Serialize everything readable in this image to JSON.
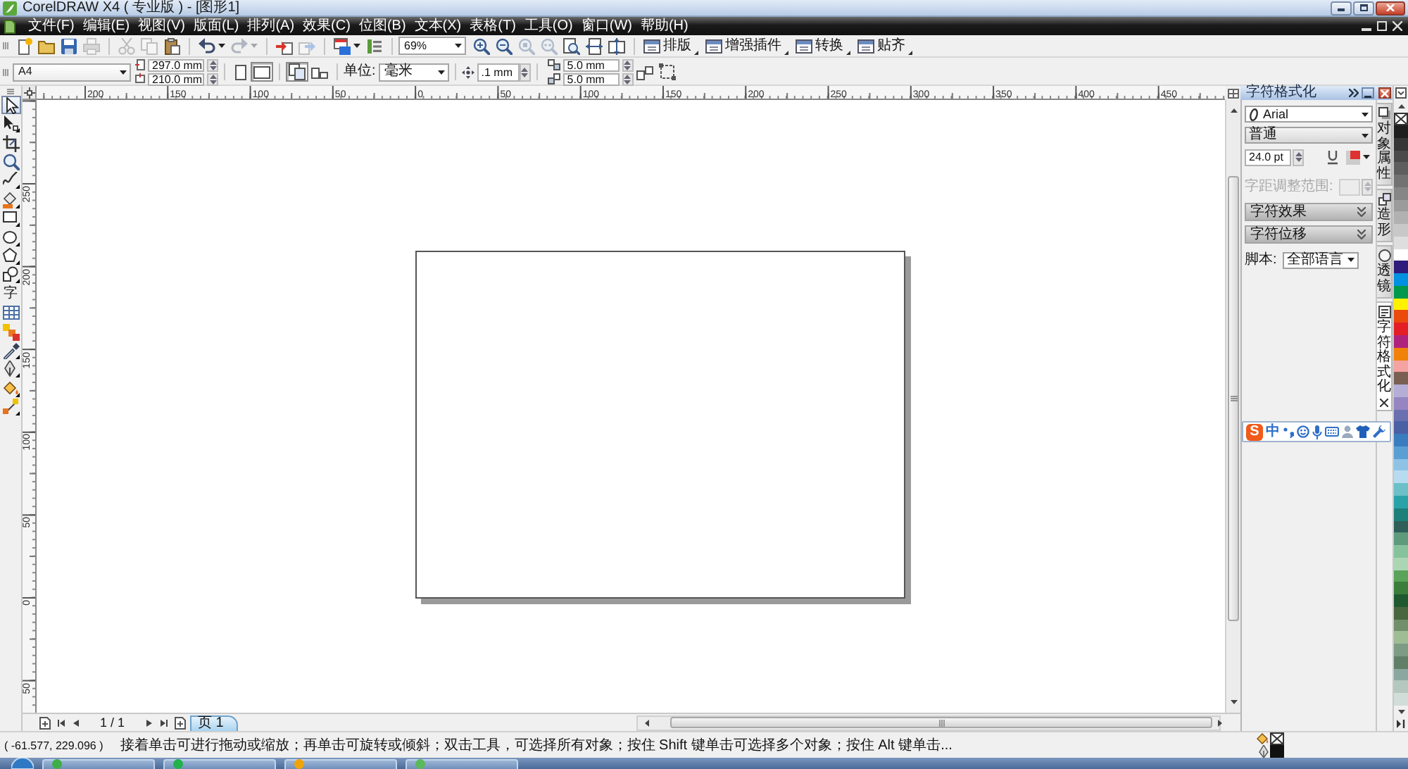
{
  "window": {
    "title": "CorelDRAW X4 ( 专业版 ) - [图形1]"
  },
  "menu": [
    "文件(F)",
    "编辑(E)",
    "视图(V)",
    "版面(L)",
    "排列(A)",
    "效果(C)",
    "位图(B)",
    "文本(X)",
    "表格(T)",
    "工具(O)",
    "窗口(W)",
    "帮助(H)"
  ],
  "toolbar": {
    "groups": [
      [
        {
          "kind": "new",
          "disabled": false
        },
        {
          "kind": "open",
          "disabled": false
        },
        {
          "kind": "save",
          "disabled": false
        },
        {
          "kind": "print",
          "disabled": true
        }
      ],
      [
        {
          "kind": "cut",
          "disabled": true
        },
        {
          "kind": "copy",
          "disabled": true
        },
        {
          "kind": "paste",
          "disabled": false
        }
      ],
      [
        {
          "kind": "undo",
          "disabled": false
        },
        {
          "kind": "redo",
          "disabled": true
        }
      ],
      [
        {
          "kind": "import",
          "disabled": false
        },
        {
          "kind": "export",
          "disabled": true
        }
      ],
      [
        {
          "kind": "launcher",
          "disabled": false
        },
        {
          "kind": "welcome",
          "disabled": false
        }
      ]
    ],
    "zoom_level": "69%",
    "zoom_tools": [
      {
        "kind": "zoom-in",
        "disabled": false
      },
      {
        "kind": "zoom-out",
        "disabled": false
      },
      {
        "kind": "zoom-selected",
        "disabled": true
      },
      {
        "kind": "zoom-all",
        "disabled": true
      },
      {
        "kind": "zoom-page",
        "disabled": false
      },
      {
        "kind": "zoom-width",
        "disabled": false
      },
      {
        "kind": "zoom-height",
        "disabled": false
      }
    ],
    "commands": [
      {
        "label": "排版"
      },
      {
        "label": "增强插件"
      },
      {
        "label": "转换"
      },
      {
        "label": "贴齐"
      }
    ]
  },
  "property_bar": {
    "paper_size": "A4",
    "width": "297.0 mm",
    "height": "210.0 mm",
    "orientations": [
      {
        "kind": "portrait",
        "selected": false
      },
      {
        "kind": "landscape",
        "selected": true
      }
    ],
    "page_scope": [
      {
        "kind": "all-pages",
        "selected": true
      },
      {
        "kind": "current-page",
        "selected": false
      }
    ],
    "units_label": "单位:",
    "units": "毫米",
    "nudge": ".1 mm",
    "duplicate_x": "5.0 mm",
    "duplicate_y": "5.0 mm"
  },
  "toolbox": [
    {
      "kind": "pick",
      "selected": true
    },
    {
      "kind": "shape",
      "selected": false
    },
    {
      "kind": "crop",
      "selected": false
    },
    {
      "kind": "zoom",
      "selected": false
    },
    {
      "kind": "freehand",
      "selected": false
    },
    {
      "kind": "smart-fill",
      "selected": false
    },
    {
      "kind": "rectangle",
      "selected": false
    },
    {
      "kind": "ellipse",
      "selected": false
    },
    {
      "kind": "polygon",
      "selected": false
    },
    {
      "kind": "basic-shapes",
      "selected": false
    },
    {
      "kind": "text",
      "glyph": "字",
      "selected": false
    },
    {
      "kind": "table",
      "selected": false
    },
    {
      "kind": "blend",
      "selected": false
    },
    {
      "kind": "eyedropper",
      "selected": false
    },
    {
      "kind": "outline",
      "selected": false
    },
    {
      "kind": "fill",
      "selected": false
    },
    {
      "kind": "interactive-fill",
      "selected": false
    }
  ],
  "rulers": {
    "horizontal": [
      "200",
      "150",
      "100",
      "50",
      "0",
      "50",
      "100",
      "150",
      "200",
      "250",
      "300",
      "350",
      "400",
      "450"
    ],
    "vertical": [
      "250",
      "200",
      "150",
      "100",
      "50",
      "0",
      "50"
    ]
  },
  "page_navigator": {
    "counter": "1 / 1",
    "pages": [
      {
        "label": "页 1",
        "selected": true
      }
    ]
  },
  "docker": {
    "title": "字符格式化",
    "font": "Arial",
    "style": "普通",
    "size": "24.0 pt",
    "kerning": {
      "label": "字距调整范围:",
      "disabled": true
    },
    "sections": [
      {
        "label": "字符效果",
        "expanded": false
      },
      {
        "label": "字符位移",
        "expanded": false
      }
    ],
    "script": {
      "label": "脚本:",
      "value": "全部语言"
    }
  },
  "docker_tabs": [
    {
      "kind": "properties",
      "label": "对象属性",
      "selected": false
    },
    {
      "kind": "shaping",
      "label": "造形",
      "selected": false
    },
    {
      "kind": "lens",
      "label": "透镜",
      "selected": false
    },
    {
      "kind": "character",
      "label": "字符格式化",
      "selected": true
    }
  ],
  "palette": [
    {
      "color": "#1e1e1e"
    },
    {
      "color": "#363636"
    },
    {
      "color": "#4a4a4a"
    },
    {
      "color": "#5e5e5e"
    },
    {
      "color": "#727272"
    },
    {
      "color": "#868686"
    },
    {
      "color": "#9b9b9b"
    },
    {
      "color": "#b1b1b1"
    },
    {
      "color": "#c8c8c8"
    },
    {
      "color": "#dedede"
    },
    {
      "color": "#ffffff"
    },
    {
      "color": "#2e1a7a"
    },
    {
      "color": "#0091e0"
    },
    {
      "color": "#00984a"
    },
    {
      "color": "#fff200"
    },
    {
      "color": "#ea4b0c"
    },
    {
      "color": "#e31e24"
    },
    {
      "color": "#b0237d"
    },
    {
      "color": "#f0820a"
    },
    {
      "color": "#f5a3a0"
    },
    {
      "color": "#7a6052"
    },
    {
      "color": "#b5aed6"
    },
    {
      "color": "#9585c0"
    },
    {
      "color": "#6a6fb0"
    },
    {
      "color": "#4b5fa5"
    },
    {
      "color": "#3a7cc0"
    },
    {
      "color": "#5a9fd4"
    },
    {
      "color": "#8ec3e6"
    },
    {
      "color": "#b8dcef"
    },
    {
      "color": "#6cc0c8"
    },
    {
      "color": "#2aa3a8"
    },
    {
      "color": "#1b7f7a"
    },
    {
      "color": "#2e5f58"
    },
    {
      "color": "#5e9a7c"
    },
    {
      "color": "#86c29c"
    },
    {
      "color": "#abd6b4"
    },
    {
      "color": "#5aa35a"
    },
    {
      "color": "#3b7d3b"
    },
    {
      "color": "#1f5a2e"
    },
    {
      "color": "#49673f"
    },
    {
      "color": "#718f68"
    },
    {
      "color": "#9fbd95"
    },
    {
      "color": "#7d9c84"
    },
    {
      "color": "#5f8067"
    },
    {
      "color": "#8aa8a0"
    },
    {
      "color": "#b4c8c0"
    },
    {
      "color": "#d0ddd8"
    }
  ],
  "ime_toolbar": {
    "logo": "S",
    "mode": "中"
  },
  "status_bar": {
    "coordinates": "( -61.577, 229.096 )",
    "hint": "接着单击可进行拖动或缩放；再单击可旋转或倾斜；双击工具，可选择所有对象；按住 Shift 键单击可选择多个对象；按住 Alt 键单击..."
  },
  "taskbar": {
    "buttons": [
      {
        "color": "#3fae49"
      },
      {
        "color": "#22b14c"
      },
      {
        "color": "#f0a30a"
      },
      {
        "color": "#5cb85c"
      }
    ]
  }
}
